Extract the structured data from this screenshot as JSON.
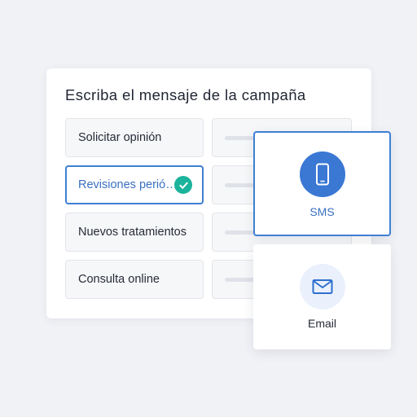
{
  "campaign": {
    "title": "Escriba el mensaje de la campaña",
    "options": [
      {
        "label": "Solicitar opinión",
        "selected": false
      },
      {
        "label": "Revisiones perió…",
        "selected": true
      },
      {
        "label": "Nuevos tratamientos",
        "selected": false
      },
      {
        "label": "Consulta online",
        "selected": false
      }
    ]
  },
  "channels": {
    "sms": {
      "label": "SMS",
      "icon": "phone-icon",
      "selected": true
    },
    "email": {
      "label": "Email",
      "icon": "envelope-icon",
      "selected": false
    }
  },
  "colors": {
    "accent": "#3f7fd3",
    "check": "#1cb39c",
    "email_icon_bg": "#eaf1fc"
  }
}
